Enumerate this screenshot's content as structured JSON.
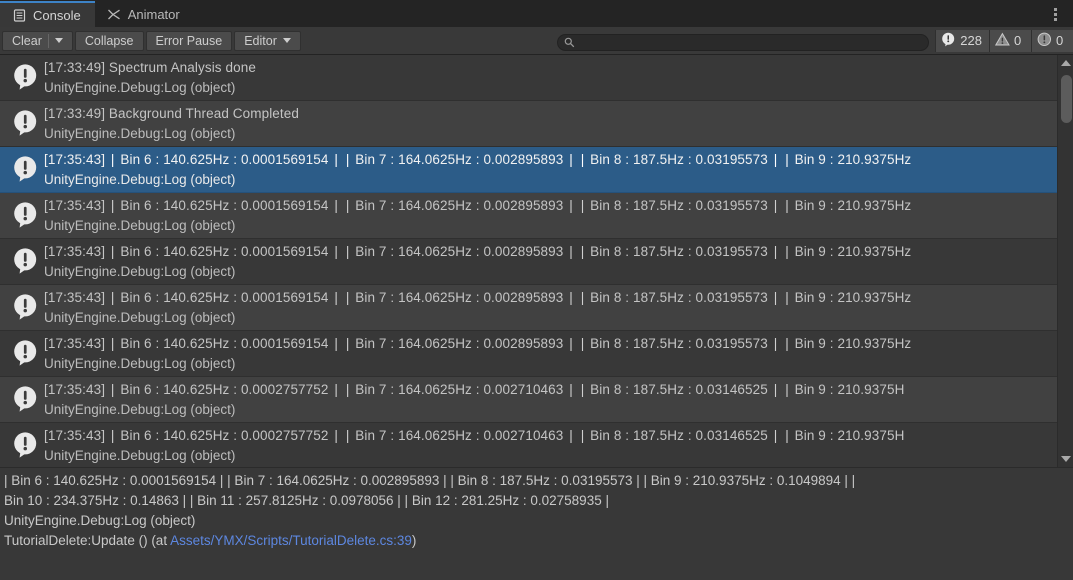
{
  "window": {
    "tabs": [
      {
        "label": "Console",
        "icon": "console-icon",
        "active": true
      },
      {
        "label": "Animator",
        "icon": "animator-icon",
        "active": false
      }
    ],
    "menu_icon": "vertical-ellipsis-icon"
  },
  "toolbar": {
    "clear_label": "Clear",
    "clear_dropdown_icon": "chevron-down-icon",
    "collapse_label": "Collapse",
    "error_pause_label": "Error Pause",
    "editor_label": "Editor",
    "editor_dropdown_icon": "chevron-down-icon",
    "search": {
      "value": "",
      "placeholder": "",
      "icon": "search-icon"
    },
    "counters": [
      {
        "name": "log-count",
        "icon": "log-bubble-icon",
        "value": "228"
      },
      {
        "name": "warning-count",
        "icon": "warning-triangle-icon",
        "value": "0"
      },
      {
        "name": "error-count",
        "icon": "error-circle-icon",
        "value": "0"
      }
    ]
  },
  "log_list": {
    "scrollbar": {
      "up_icon": "scroll-up-arrow-icon",
      "down_icon": "scroll-down-arrow-icon"
    },
    "rows": [
      {
        "icon": "log-bubble-icon",
        "selected": false,
        "timestamp": "[17:33:49]",
        "message": "Spectrum Analysis done",
        "segments": [],
        "stack": "UnityEngine.Debug:Log (object)"
      },
      {
        "icon": "log-bubble-icon",
        "selected": false,
        "timestamp": "[17:33:49]",
        "message": "Background Thread Completed",
        "segments": [],
        "stack": "UnityEngine.Debug:Log (object)"
      },
      {
        "icon": "log-bubble-icon",
        "selected": true,
        "timestamp": "[17:35:43]",
        "message": "",
        "segments": [
          "Bin 6 : 140.625Hz : 0.0001569154",
          "Bin 7 : 164.0625Hz : 0.002895893",
          "Bin 8 : 187.5Hz : 0.03195573",
          "Bin 9 : 210.9375Hz"
        ],
        "stack": "UnityEngine.Debug:Log (object)"
      },
      {
        "icon": "log-bubble-icon",
        "selected": false,
        "timestamp": "[17:35:43]",
        "message": "",
        "segments": [
          "Bin 6 : 140.625Hz : 0.0001569154",
          "Bin 7 : 164.0625Hz : 0.002895893",
          "Bin 8 : 187.5Hz : 0.03195573",
          "Bin 9 : 210.9375Hz"
        ],
        "stack": "UnityEngine.Debug:Log (object)"
      },
      {
        "icon": "log-bubble-icon",
        "selected": false,
        "timestamp": "[17:35:43]",
        "message": "",
        "segments": [
          "Bin 6 : 140.625Hz : 0.0001569154",
          "Bin 7 : 164.0625Hz : 0.002895893",
          "Bin 8 : 187.5Hz : 0.03195573",
          "Bin 9 : 210.9375Hz"
        ],
        "stack": "UnityEngine.Debug:Log (object)"
      },
      {
        "icon": "log-bubble-icon",
        "selected": false,
        "timestamp": "[17:35:43]",
        "message": "",
        "segments": [
          "Bin 6 : 140.625Hz : 0.0001569154",
          "Bin 7 : 164.0625Hz : 0.002895893",
          "Bin 8 : 187.5Hz : 0.03195573",
          "Bin 9 : 210.9375Hz"
        ],
        "stack": "UnityEngine.Debug:Log (object)"
      },
      {
        "icon": "log-bubble-icon",
        "selected": false,
        "timestamp": "[17:35:43]",
        "message": "",
        "segments": [
          "Bin 6 : 140.625Hz : 0.0001569154",
          "Bin 7 : 164.0625Hz : 0.002895893",
          "Bin 8 : 187.5Hz : 0.03195573",
          "Bin 9 : 210.9375Hz"
        ],
        "stack": "UnityEngine.Debug:Log (object)"
      },
      {
        "icon": "log-bubble-icon",
        "selected": false,
        "timestamp": "[17:35:43]",
        "message": "",
        "segments": [
          "Bin 6 : 140.625Hz : 0.0002757752",
          "Bin 7 : 164.0625Hz : 0.002710463",
          "Bin 8 : 187.5Hz : 0.03146525",
          "Bin 9 : 210.9375H"
        ],
        "stack": "UnityEngine.Debug:Log (object)"
      },
      {
        "icon": "log-bubble-icon",
        "selected": false,
        "timestamp": "[17:35:43]",
        "message": "",
        "segments": [
          "Bin 6 : 140.625Hz : 0.0002757752",
          "Bin 7 : 164.0625Hz : 0.002710463",
          "Bin 8 : 187.5Hz : 0.03146525",
          "Bin 9 : 210.9375H"
        ],
        "stack": "UnityEngine.Debug:Log (object)"
      }
    ]
  },
  "detail": {
    "line1": "| Bin 6 : 140.625Hz : 0.0001569154 |  | Bin 7 : 164.0625Hz : 0.002895893 |  | Bin 8 : 187.5Hz : 0.03195573 |  | Bin 9 : 210.9375Hz : 0.1049894 |  |",
    "line2": "Bin 10 : 234.375Hz : 0.14863 |  | Bin 11 : 257.8125Hz : 0.0978056 |  | Bin 12 : 281.25Hz : 0.02758935 |",
    "line3": "UnityEngine.Debug:Log (object)",
    "line4_prefix": "TutorialDelete:Update () (at ",
    "line4_link": "Assets/YMX/Scripts/TutorialDelete.cs:39",
    "line4_suffix": ")"
  }
}
